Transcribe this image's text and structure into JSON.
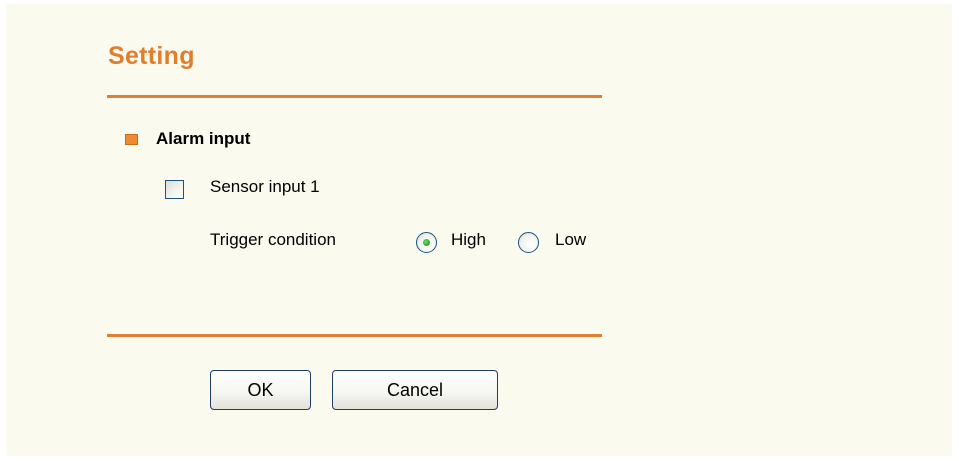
{
  "header": {
    "title": "Setting"
  },
  "section": {
    "title": "Alarm input"
  },
  "sensor": {
    "label": "Sensor input 1",
    "checked": false
  },
  "trigger": {
    "label": "Trigger condition",
    "options": [
      {
        "label": "High",
        "selected": true
      },
      {
        "label": "Low",
        "selected": false
      }
    ]
  },
  "buttons": {
    "ok_label": "OK",
    "cancel_label": "Cancel"
  },
  "colors": {
    "accent": "#e07e2e",
    "background": "#fbfaef",
    "radio_selected": "#2aa21f",
    "control_border": "#1c5180"
  }
}
